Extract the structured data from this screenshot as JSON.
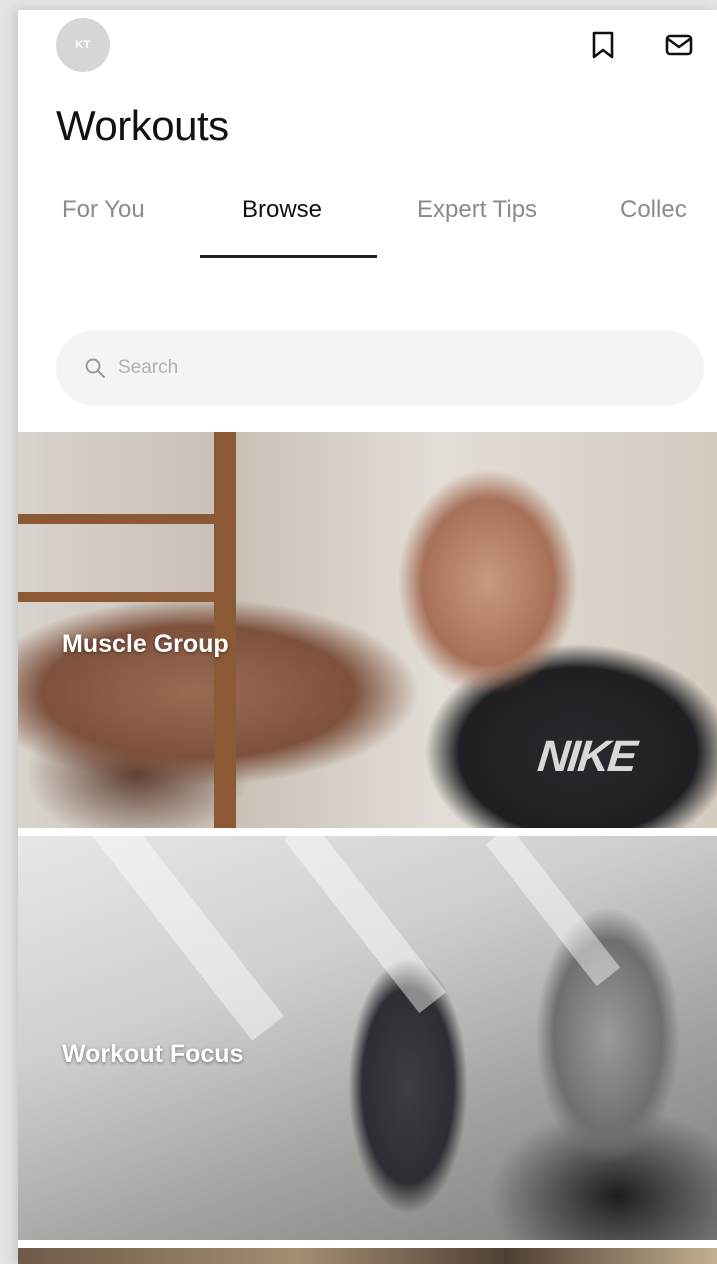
{
  "header": {
    "avatar_initials": "KT",
    "title": "Workouts",
    "icons": [
      "bookmark-icon",
      "inbox-icon"
    ]
  },
  "tabs": [
    {
      "label": "For You",
      "active": false
    },
    {
      "label": "Browse",
      "active": true
    },
    {
      "label": "Expert Tips",
      "active": false
    },
    {
      "label": "Collec",
      "active": false
    }
  ],
  "search": {
    "placeholder": "Search",
    "value": ""
  },
  "cards": [
    {
      "label": "Muscle Group"
    },
    {
      "label": "Workout Focus"
    }
  ],
  "brand": {
    "logo_text": "NIKE"
  },
  "colors": {
    "active_tab": "#111111",
    "inactive_tab": "#8a8a8a",
    "search_bg": "#f4f4f4"
  }
}
